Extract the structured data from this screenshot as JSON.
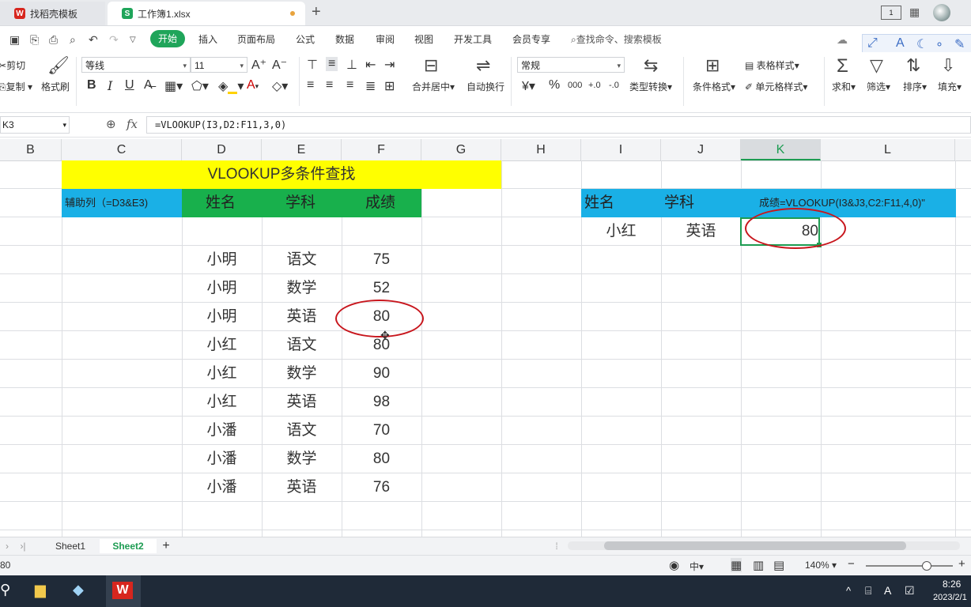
{
  "tabs": [
    {
      "label": "找稻壳模板",
      "icon": "docer-icon",
      "color": "#d7261e"
    },
    {
      "label": "工作簿1.xlsx",
      "icon": "spreadsheet-icon",
      "color": "#1fa55a"
    }
  ],
  "menu": {
    "start": "开始",
    "items": [
      "插入",
      "页面布局",
      "公式",
      "数据",
      "审阅",
      "视图",
      "开发工具",
      "会员专享"
    ],
    "search": "查找命令、搜索模板"
  },
  "ribbon": {
    "cut": "剪切",
    "copy": "复制",
    "format_painter": "格式刷",
    "font_name": "等线",
    "font_size": "11",
    "merge_center": "合并居中",
    "auto_wrap": "自动换行",
    "number_format": "常规",
    "type_convert": "类型转换",
    "conditional_format": "条件格式",
    "table_style": "表格样式",
    "cell_style": "单元格样式",
    "sum": "求和",
    "filter": "筛选",
    "sort": "排序",
    "fill": "填充"
  },
  "formula_bar": {
    "name_box": "K3",
    "formula": "=VLOOKUP(I3,D2:F11,3,0)"
  },
  "columns": [
    "B",
    "C",
    "D",
    "E",
    "F",
    "G",
    "H",
    "I",
    "J",
    "K",
    "L"
  ],
  "active_column": "K",
  "sheet": {
    "title": "VLOOKUP多条件查找",
    "helper_header": "辅助列（=D3&E3)",
    "headers": [
      "姓名",
      "学科",
      "成绩"
    ],
    "rows": [
      [
        "小明",
        "语文",
        "75"
      ],
      [
        "小明",
        "数学",
        "52"
      ],
      [
        "小明",
        "英语",
        "80"
      ],
      [
        "小红",
        "语文",
        "80"
      ],
      [
        "小红",
        "数学",
        "90"
      ],
      [
        "小红",
        "英语",
        "98"
      ],
      [
        "小潘",
        "语文",
        "70"
      ],
      [
        "小潘",
        "数学",
        "80"
      ],
      [
        "小潘",
        "英语",
        "76"
      ]
    ],
    "lookup_headers": [
      "姓名",
      "学科"
    ],
    "lookup_formula_note": "成绩=VLOOKUP(I3&J3,C2:F11,4,0)\"",
    "lookup_name": "小红",
    "lookup_subject": "英语",
    "lookup_result": "80"
  },
  "sheet_tabs": [
    "Sheet1",
    "Sheet2"
  ],
  "active_sheet": "Sheet2",
  "status": {
    "value": "80",
    "zoom": "140%"
  },
  "taskbar": {
    "time": "8:26",
    "date": "2023/2/1"
  },
  "colors": {
    "yellow": "#ffff00",
    "green_header": "#18b04c",
    "blue_header": "#1ab0e6",
    "annotation_red": "#c8161d",
    "accent_green": "#1fa55a"
  }
}
